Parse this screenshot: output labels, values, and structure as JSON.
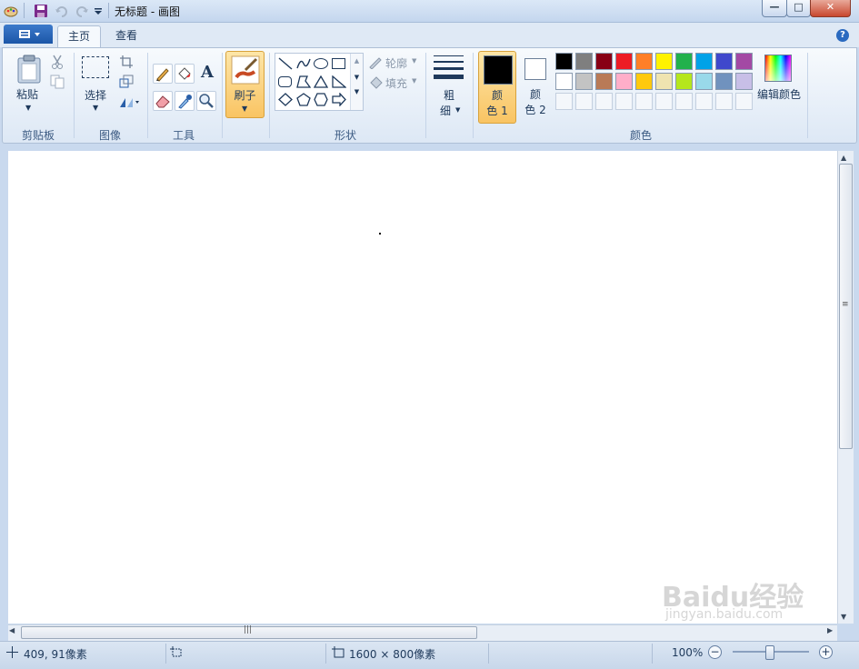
{
  "window": {
    "title": "无标题 - 画图"
  },
  "tabs": [
    {
      "label": "主页"
    },
    {
      "label": "查看"
    }
  ],
  "clipboard": {
    "paste_label": "粘贴",
    "group_label": "剪贴板"
  },
  "image": {
    "select_label": "选择",
    "group_label": "图像"
  },
  "tools": {
    "group_label": "工具"
  },
  "brush": {
    "label": "刷子"
  },
  "shapes": {
    "outline_label": "轮廓",
    "fill_label": "填充",
    "group_label": "形状"
  },
  "size": {
    "label_line1": "粗",
    "label_line2": "细"
  },
  "colors": {
    "color1_line1": "颜",
    "color1_line2": "色 1",
    "color2_line1": "颜",
    "color2_line2": "色 2",
    "edit_label": "编辑颜色",
    "group_label": "颜色",
    "color1_value": "#000000",
    "color2_value": "#ffffff",
    "palette_row1": [
      "#000000",
      "#7f7f7f",
      "#880015",
      "#ed1c24",
      "#ff7f27",
      "#fff200",
      "#22b14c",
      "#00a2e8",
      "#3f48cc",
      "#a349a4"
    ],
    "palette_row2": [
      "#ffffff",
      "#c3c3c3",
      "#b97a57",
      "#ffaec9",
      "#ffc90e",
      "#efe4b0",
      "#b5e61d",
      "#99d9ea",
      "#7092be",
      "#c8bfe7"
    ]
  },
  "status": {
    "cursor_position": "409, 91像素",
    "canvas_size": "1600 × 800像素",
    "zoom": "100%"
  },
  "watermark": {
    "text": "Baidu经验",
    "sub": "jingyan.baidu.com"
  }
}
